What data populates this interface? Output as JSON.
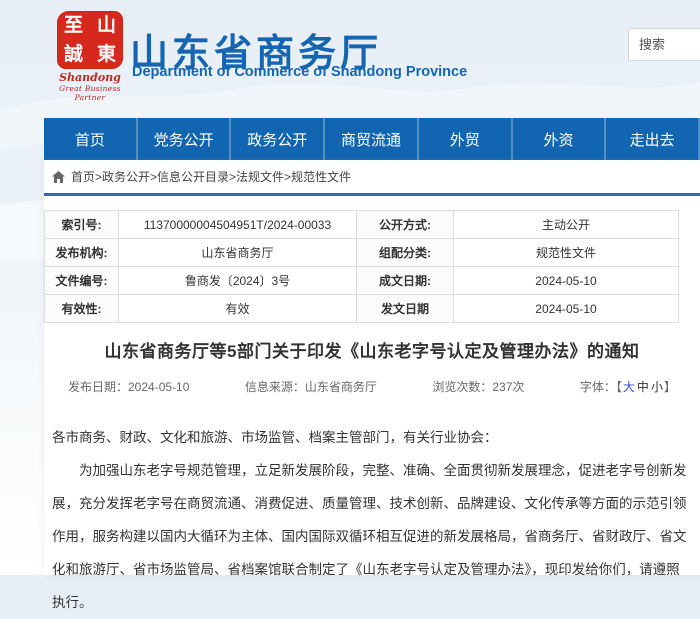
{
  "header": {
    "seal_chars": {
      "c0": "至",
      "c1": "山",
      "c2": "誠",
      "c3": "東"
    },
    "logo_en1": "Shandong",
    "logo_en2": "Great Business Partner",
    "site_title": "山东省商务厅",
    "site_subtitle": "Department of Commerce of Shandong Province",
    "search_placeholder": "搜索"
  },
  "nav": {
    "items": [
      {
        "label": "首页"
      },
      {
        "label": "党务公开"
      },
      {
        "label": "政务公开"
      },
      {
        "label": "商贸流通"
      },
      {
        "label": "外贸"
      },
      {
        "label": "外资"
      },
      {
        "label": "走出去"
      }
    ]
  },
  "breadcrumb": {
    "text": "首页>政务公开>信息公开目录>法规文件>规范性文件"
  },
  "doc_table": {
    "rows": [
      {
        "label1": "索引号:",
        "value1": "11370000004504951T/2024-00033",
        "label2": "公开方式:",
        "value2": "主动公开"
      },
      {
        "label1": "发布机构:",
        "value1": "山东省商务厅",
        "label2": "组配分类:",
        "value2": "规范性文件"
      },
      {
        "label1": "文件编号:",
        "value1": "鲁商发〔2024〕3号",
        "label2": "成文日期:",
        "value2": "2024-05-10"
      },
      {
        "label1": "有效性:",
        "value1": "有效",
        "label2": "发文日期",
        "value2": "2024-05-10"
      }
    ]
  },
  "article": {
    "title": "山东省商务厅等5部门关于印发《山东老字号认定及管理办法》的通知",
    "publish_date": "发布日期：2024-05-10",
    "source": "信息来源：山东省商务厅",
    "views": "浏览次数：237次",
    "font_label": "字体：【",
    "font_large": "大",
    "font_mid": "中",
    "font_small": "小",
    "font_bracket_close": "】",
    "paragraphs": {
      "p0": "各市商务、财政、文化和旅游、市场监管、档案主管部门，有关行业协会：",
      "p1": "为加强山东老字号规范管理，立足新发展阶段，完整、准确、全面贯彻新发展理念，促进老字号创新发展，充分发挥老字号在商贸流通、消费促进、质量管理、技术创新、品牌建设、文化传承等方面的示范引领作用，服务构建以国内大循环为主体、国内国际双循环相互促进的新发展格局，省商务厅、省财政厅、省文化和旅游厅、省市场监管局、省档案馆联合制定了《山东老字号认定及管理办法》，现印发给你们，请遵照执行。"
    }
  },
  "colors": {
    "nav_blue": "#1266b1",
    "title_blue": "#1565b3",
    "seal_red": "#d7281d",
    "breadcrumb_rule": "#2e6cb5",
    "font_large_link": "#3747d6"
  }
}
